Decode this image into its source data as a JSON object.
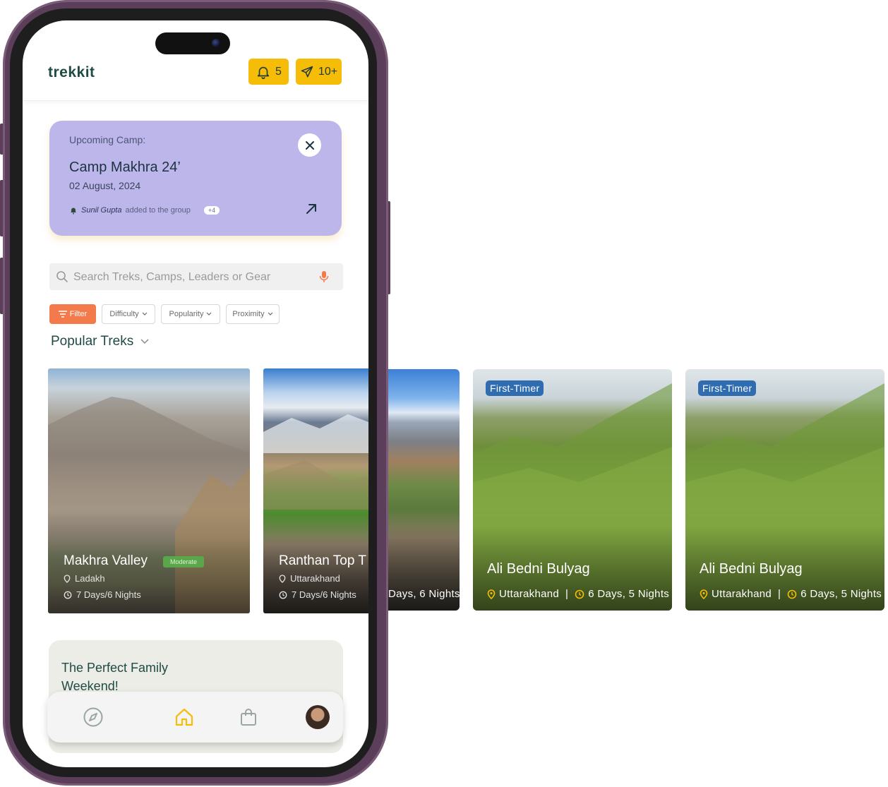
{
  "app": {
    "logo": "trekkit",
    "notifications_count": "5",
    "messages_count": "10+"
  },
  "camp": {
    "label": "Upcoming Camp:",
    "title": "Camp Makhra 24’",
    "date": "02 August, 2024",
    "note_name": "Sunil Gupta",
    "note_text": "added to the group",
    "note_extra": "+4"
  },
  "search": {
    "placeholder": "Search Treks, Camps, Leaders or Gear"
  },
  "filters": {
    "filter": "Filter",
    "difficulty": "Difficulty",
    "popularity": "Popularity",
    "proximity": "Proximity"
  },
  "section": {
    "popular": "Popular Treks"
  },
  "treks": [
    {
      "name": "Makhra Valley",
      "difficulty": "Moderate",
      "location": "Ladakh",
      "duration": "7 Days/6 Nights"
    },
    {
      "name": "Ranthan Top T",
      "location": "Uttarakhand",
      "duration": "7 Days/6 Nights"
    }
  ],
  "outside_cards": [
    {
      "duration": "Days, 6 Nights"
    },
    {
      "badge": "First-Timer",
      "name": "Ali Bedni Bulyag",
      "location": "Uttarakhand",
      "separator": "|",
      "duration": "6 Days, 5 Nights"
    },
    {
      "badge": "First-Timer",
      "name": "Ali Bedni Bulyag",
      "location": "Uttarakhand",
      "separator": "|",
      "duration": "6 Days, 5 Nights"
    }
  ],
  "family": {
    "title": "The Perfect Family Weekend!"
  },
  "colors": {
    "accent_yellow": "#f5bc08",
    "camp_purple": "#bdb6eb",
    "filter_orange": "#f37a4a",
    "brand_green": "#1f4a45",
    "badge_blue": "#2f6db0"
  },
  "icons": [
    "bell-icon",
    "send-icon",
    "close-icon",
    "arrow-up-right-icon",
    "search-icon",
    "mic-icon",
    "filter-icon",
    "chevron-down-icon",
    "pin-icon",
    "clock-icon",
    "compass-icon",
    "home-icon",
    "bag-icon",
    "avatar"
  ]
}
